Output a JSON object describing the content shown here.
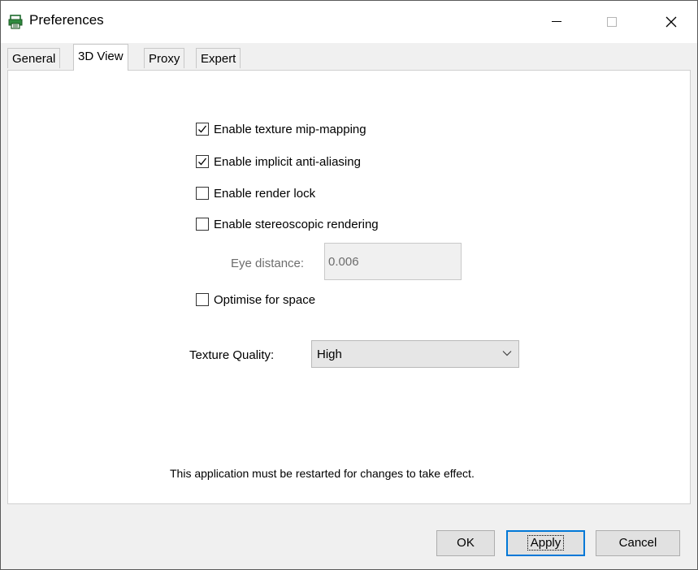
{
  "window": {
    "title": "Preferences",
    "app_icon": "printer-app-icon",
    "controls": {
      "minimize": "minimize-icon",
      "maximize": "maximize-icon",
      "close": "close-icon"
    }
  },
  "tabs": [
    {
      "label": "General",
      "active": false
    },
    {
      "label": "3D View",
      "active": true
    },
    {
      "label": "Proxy",
      "active": false
    },
    {
      "label": "Expert",
      "active": false
    }
  ],
  "options": [
    {
      "label": "Enable texture mip-mapping",
      "checked": true
    },
    {
      "label": "Enable implicit anti-aliasing",
      "checked": true
    },
    {
      "label": "Enable render lock",
      "checked": false
    },
    {
      "label": "Enable stereoscopic rendering",
      "checked": false
    },
    {
      "label": "Optimise for space",
      "checked": false
    }
  ],
  "eye_distance": {
    "label": "Eye distance:",
    "value": "0.006",
    "disabled": true
  },
  "texture_quality": {
    "label": "Texture Quality:",
    "selected": "High"
  },
  "restart_notice": "This application must be restarted for changes to take effect.",
  "buttons": {
    "ok": "OK",
    "apply": "Apply",
    "cancel": "Cancel"
  },
  "colors": {
    "focus_border": "#0078d7",
    "panel_bg": "#ffffff",
    "dialog_bg": "#f0f0f0",
    "disabled_text": "#6d6d6d"
  }
}
